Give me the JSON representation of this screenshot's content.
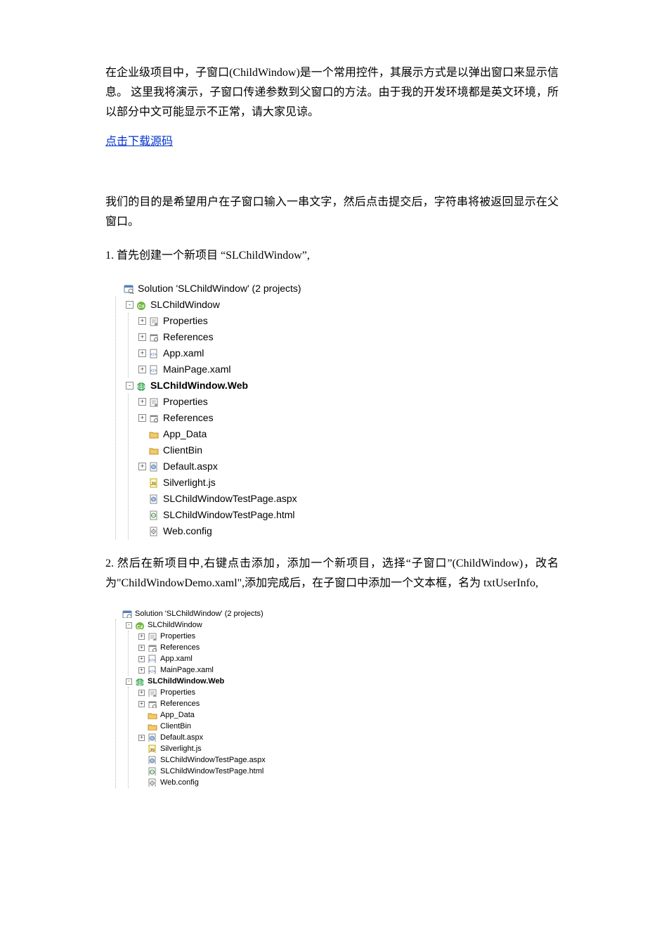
{
  "intro_paragraph": "在企业级项目中，子窗口(ChildWindow)是一个常用控件，其展示方式是以弹出窗口来显示信息。  这里我将演示，子窗口传递参数到父窗口的方法。由于我的开发环境都是英文环境，所以部分中文可能显示不正常，请大家见谅。",
  "download_link": "点击下载源码",
  "goal_paragraph": "我们的目的是希望用户在子窗口输入一串文字，然后点击提交后，字符串将被返回显示在父窗口。",
  "step1": "1.  首先创建一个新项目  “SLChildWindow”,",
  "step2": "2.  然后在新项目中,右键点击添加，添加一个新项目，选择“子窗口”(ChildWindow)，改名为\"ChildWindowDemo.xaml\",添加完成后，在子窗口中添加一个文本框，名为 txtUserInfo,",
  "tree1": {
    "root": {
      "label": "Solution 'SLChildWindow' (2 projects)"
    },
    "p1": {
      "label": "SLChildWindow"
    },
    "p1_props": {
      "label": "Properties"
    },
    "p1_refs": {
      "label": "References"
    },
    "p1_appx": {
      "label": "App.xaml"
    },
    "p1_main": {
      "label": "MainPage.xaml"
    },
    "p2": {
      "label": "SLChildWindow.Web"
    },
    "p2_props": {
      "label": "Properties"
    },
    "p2_refs": {
      "label": "References"
    },
    "p2_appd": {
      "label": "App_Data"
    },
    "p2_cbin": {
      "label": "ClientBin"
    },
    "p2_defx": {
      "label": "Default.aspx"
    },
    "p2_sljs": {
      "label": "Silverlight.js"
    },
    "p2_tpax": {
      "label": "SLChildWindowTestPage.aspx"
    },
    "p2_tphm": {
      "label": "SLChildWindowTestPage.html"
    },
    "p2_wcfg": {
      "label": "Web.config"
    }
  },
  "tree2": {
    "root": {
      "label": "Solution 'SLChildWindow' (2 projects)"
    },
    "p1": {
      "label": "SLChildWindow"
    },
    "p1_props": {
      "label": "Properties"
    },
    "p1_refs": {
      "label": "References"
    },
    "p1_appx": {
      "label": "App.xaml"
    },
    "p1_main": {
      "label": "MainPage.xaml"
    },
    "p2": {
      "label": "SLChildWindow.Web"
    },
    "p2_props": {
      "label": "Properties"
    },
    "p2_refs": {
      "label": "References"
    },
    "p2_appd": {
      "label": "App_Data"
    },
    "p2_cbin": {
      "label": "ClientBin"
    },
    "p2_defx": {
      "label": "Default.aspx"
    },
    "p2_sljs": {
      "label": "Silverlight.js"
    },
    "p2_tpax": {
      "label": "SLChildWindowTestPage.aspx"
    },
    "p2_tphm": {
      "label": "SLChildWindowTestPage.html"
    },
    "p2_wcfg": {
      "label": "Web.config"
    }
  }
}
